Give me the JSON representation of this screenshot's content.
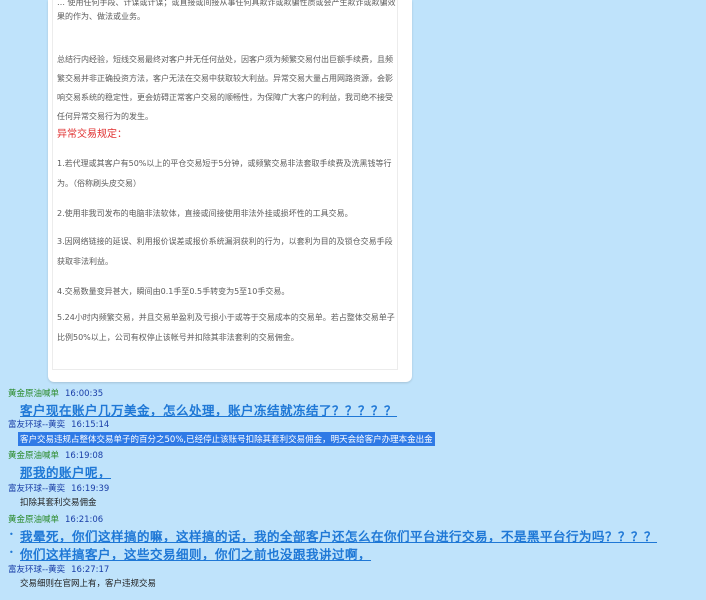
{
  "document": {
    "top_line1": "… 使用任何手段、计谋或计谋；或直接或间接从事任何具欺诈或欺骗性质或会产生欺诈或欺骗效果的作为、做法或业务。",
    "para1": "总结行内经验，短线交易最终对客户并无任何益处，因客户须为频繁交易付出巨额手续费，且频繁交易并非正确投资方法，客户无法在交易中获取较大利益。异常交易大量占用网路资源，会影响交易系统的稳定性，更会妨碍正常客户交易的顺畅性，为保障广大客户的利益，我司绝不接受任何异常交易行为的发生。",
    "section_title": "异常交易规定：",
    "rules": [
      "1.若代理或其客户有50%以上的平仓交易短于5分钟，或频繁交易非法套取手续费及洗黑钱等行为。（俗称刷头皮交易）",
      "2.使用非我司发布的电脑非法软体，直接或间接使用非法外挂或损坏性的工具交易。",
      "3.因网络链接的延误、利用报价误差或报价系统漏洞获利的行为，以套利为目的及锁仓交易手段获取非法利益。",
      "4.交易数量变异甚大，瞬间由0.1手至0.5手转变为5至10手交易。",
      "5.24小时内频繁交易，并且交易单盈利及亏损小于或等于交易成本的交易单。若占整体交易单子比例50%以上，公司有权停止该帐号并扣除其非法套利的交易佣金。"
    ]
  },
  "chat": [
    {
      "sender": "黄金原油喊单",
      "time": "16:00:35",
      "text": "客户现在账户几万美金，怎么处理，账户冻结就冻结了？？？？？"
    },
    {
      "sender": "富友环球--黄奕",
      "time": "16:15:14",
      "text": "客户交易违规占整体交易单子的百分之50%,已经停止该账号扣除其套利交易佣金，明天会给客户办理本金出金"
    },
    {
      "sender": "黄金原油喊单",
      "time": "16:19:08",
      "text": "那我的账户呢，"
    },
    {
      "sender": "富友环球--黄奕",
      "time": "16:19:39",
      "text": "扣除其套利交易佣金"
    },
    {
      "sender": "黄金原油喊单",
      "time": "16:21:06",
      "lines": [
        "我晕死，你们这样搞的嘛，这样搞的话，我的全部客户还怎么在你们平台进行交易，不是黑平台行为吗？？？？",
        "你们这样搞客户，这些交易细则，你们之前也没跟我讲过啊，"
      ]
    },
    {
      "sender": "富友环球--黄奕",
      "time": "16:27:17",
      "text": "交易细则在官网上有，客户违规交易"
    }
  ],
  "colors": {
    "background": "#bfe3fb",
    "accent": "#1f78d6",
    "selection": "#2f7ae6",
    "sender_green": "#2a8a2a",
    "sender_blue": "#1a3fa8",
    "rule_title": "#e03030"
  }
}
